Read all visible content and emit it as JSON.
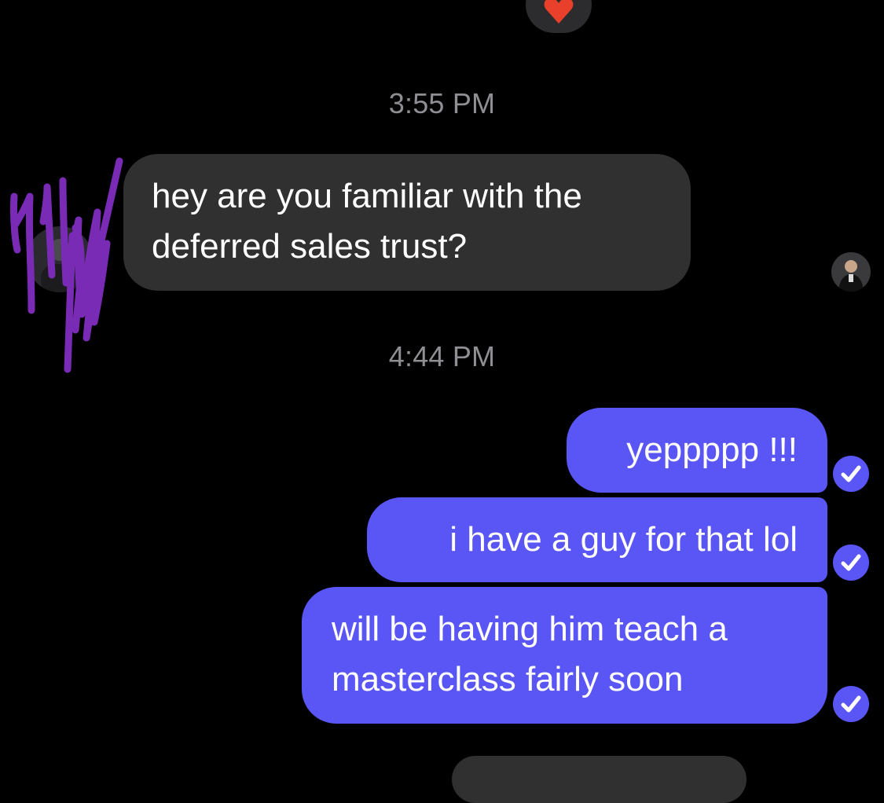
{
  "conversation": {
    "reaction_icon": "heart-emoji",
    "timestamps": [
      "3:55 PM",
      "4:44 PM"
    ],
    "incoming": {
      "line1": "hey are you familiar with the",
      "line2": "deferred sales trust?"
    },
    "outgoing": [
      {
        "text": "yeppppp !!!"
      },
      {
        "text": "i have a guy for that lol"
      },
      {
        "line1": "will be having him teach a",
        "line2": "masterclass fairly soon"
      }
    ],
    "read_icon": "checkmark-circle-icon"
  },
  "colors": {
    "background": "#000000",
    "incoming_bubble": "#303030",
    "outgoing_bubble": "#5a55f5",
    "timestamp": "#8e8e93",
    "redaction_scribble": "#7a2bb5",
    "reaction": "#e8402a"
  }
}
